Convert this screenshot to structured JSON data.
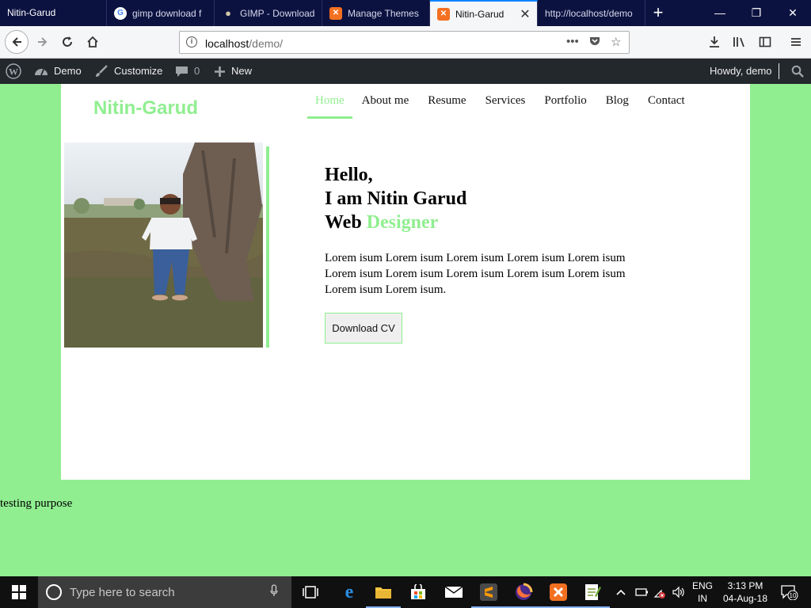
{
  "browser": {
    "tabs": [
      {
        "label": "Nitin-Garud",
        "active": false
      },
      {
        "label": "gimp download f",
        "active": false
      },
      {
        "label": "GIMP - Download",
        "active": false
      },
      {
        "label": "Manage Themes",
        "active": false
      },
      {
        "label": "Nitin-Garud",
        "active": true
      },
      {
        "label": "http://localhost/demo",
        "active": false
      }
    ],
    "url_host": "localhost",
    "url_path": "/demo/",
    "url_more": "•••"
  },
  "wp_admin": {
    "site_name": "Demo",
    "customize": "Customize",
    "comments": "0",
    "new": "New",
    "howdy": "Howdy, demo"
  },
  "site": {
    "logo": "Nitin-Garud",
    "menu": [
      "Home",
      "About me",
      "Resume",
      "Services",
      "Portfolio",
      "Blog",
      "Contact"
    ],
    "intro": {
      "line1": "Hello,",
      "line2": "I am Nitin Garud",
      "line3_prefix": "Web ",
      "line3_highlight": "Designer"
    },
    "lorem": "Lorem isum Lorem isum Lorem isum Lorem isum Lorem isum Lorem isum Lorem isum Lorem isum Lorem isum Lorem isum Lorem isum Lorem isum.",
    "cv_button": "Download CV",
    "footer_text": "testing purpose"
  },
  "taskbar": {
    "search_placeholder": "Type here to search",
    "lang_line1": "ENG",
    "lang_line2": "IN",
    "time": "3:13 PM",
    "date": "04-Aug-18",
    "notifications": "10"
  },
  "colors": {
    "accent": "#90ee90",
    "tab_bar": "#0c1240",
    "admin_bar": "#23282d"
  }
}
